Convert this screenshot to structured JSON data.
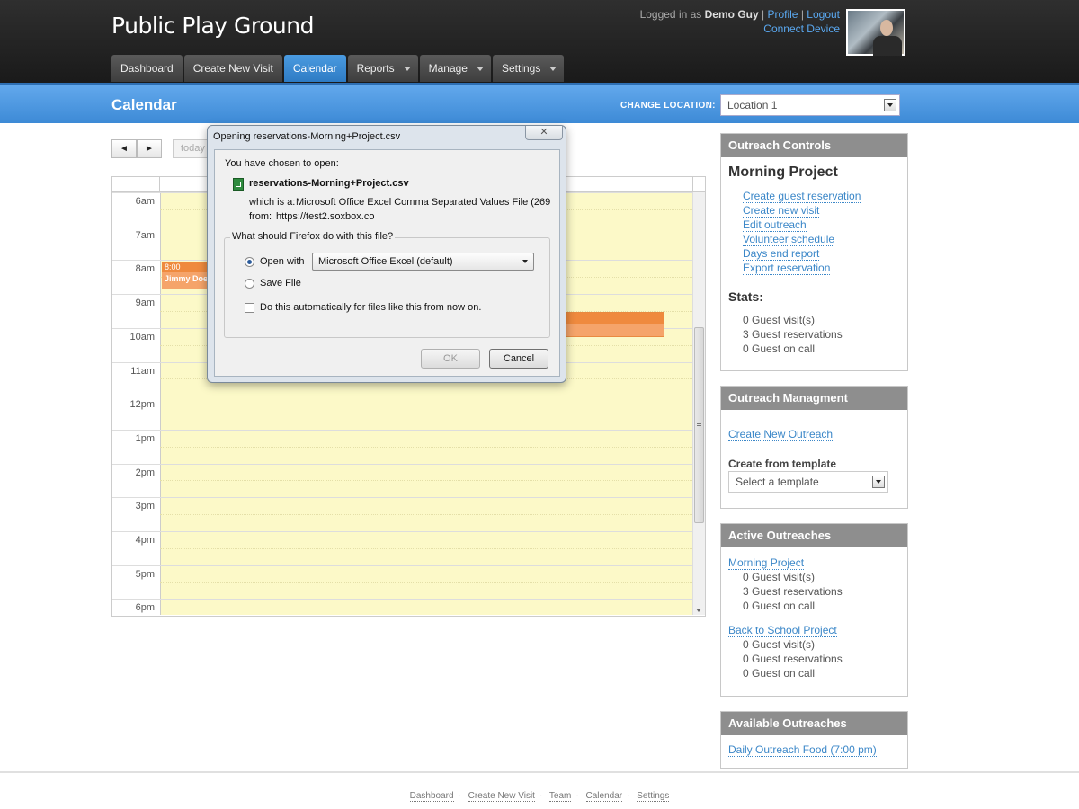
{
  "header": {
    "site_title": "Public Play Ground",
    "logged_in_prefix": "Logged in as",
    "user_name": "Demo Guy",
    "profile_link": "Profile",
    "link_sep": "|",
    "logout_link": "Logout",
    "connect_device_link": "Connect Device"
  },
  "nav": {
    "dashboard": "Dashboard",
    "create_new_visit": "Create New Visit",
    "calendar": "Calendar",
    "reports": "Reports",
    "manage": "Manage",
    "settings": "Settings"
  },
  "bluebar": {
    "page_title": "Calendar",
    "change_location_label": "CHANGE LOCATION:",
    "location_value": "Location 1"
  },
  "calendar": {
    "prev": "◄",
    "next": "►",
    "today": "today",
    "times": [
      "6am",
      "7am",
      "8am",
      "9am",
      "10am",
      "11am",
      "12pm",
      "1pm",
      "2pm",
      "3pm",
      "4pm",
      "5pm",
      "6pm"
    ],
    "event1_time": "8:00",
    "event1_name": "Jimmy Doe"
  },
  "dialog": {
    "title": "Opening reservations-Morning+Project.csv",
    "close": "✕",
    "chosen_text": "You have chosen to open:",
    "file_name": "reservations-Morning+Project.csv",
    "which_is_label": "which is a:",
    "which_is_value": "Microsoft Office Excel Comma Separated Values File (269",
    "from_label": "from:",
    "from_value": "https://test2.soxbox.co",
    "group_label": "What should Firefox do with this file?",
    "open_with_label": "Open with",
    "open_with_value": "Microsoft Office Excel (default)",
    "save_file_label": "Save File",
    "auto_label": "Do this automatically for files like this from now on.",
    "ok": "OK",
    "cancel": "Cancel"
  },
  "sidebar": {
    "outreach_controls": {
      "head": "Outreach Controls",
      "title": "Morning Project",
      "links": [
        "Create guest reservation",
        "Create new visit",
        "Edit outreach",
        "Volunteer schedule",
        "Days end report",
        "Export reservation"
      ],
      "stats_label": "Stats:",
      "stats": [
        "0 Guest visit(s)",
        "3 Guest reservations",
        "0 Guest on call"
      ]
    },
    "outreach_management": {
      "head": "Outreach Managment",
      "create_link": "Create New Outreach",
      "template_label": "Create from template",
      "template_placeholder": "Select a template"
    },
    "active_outreaches": {
      "head": "Active Outreaches",
      "items": [
        {
          "name": "Morning Project",
          "stats": [
            "0 Guest visit(s)",
            "3 Guest reservations",
            "0 Guest on call"
          ]
        },
        {
          "name": "Back to School Project",
          "stats": [
            "0 Guest visit(s)",
            "0 Guest reservations",
            "0 Guest on call"
          ]
        }
      ]
    },
    "available_outreaches": {
      "head": "Available Outreaches",
      "items": [
        "Daily Outreach Food (7:00 pm)"
      ]
    }
  },
  "footer": {
    "links": [
      "Dashboard",
      "Create New Visit",
      "Team",
      "Calendar",
      "Settings"
    ],
    "sep": "·"
  }
}
